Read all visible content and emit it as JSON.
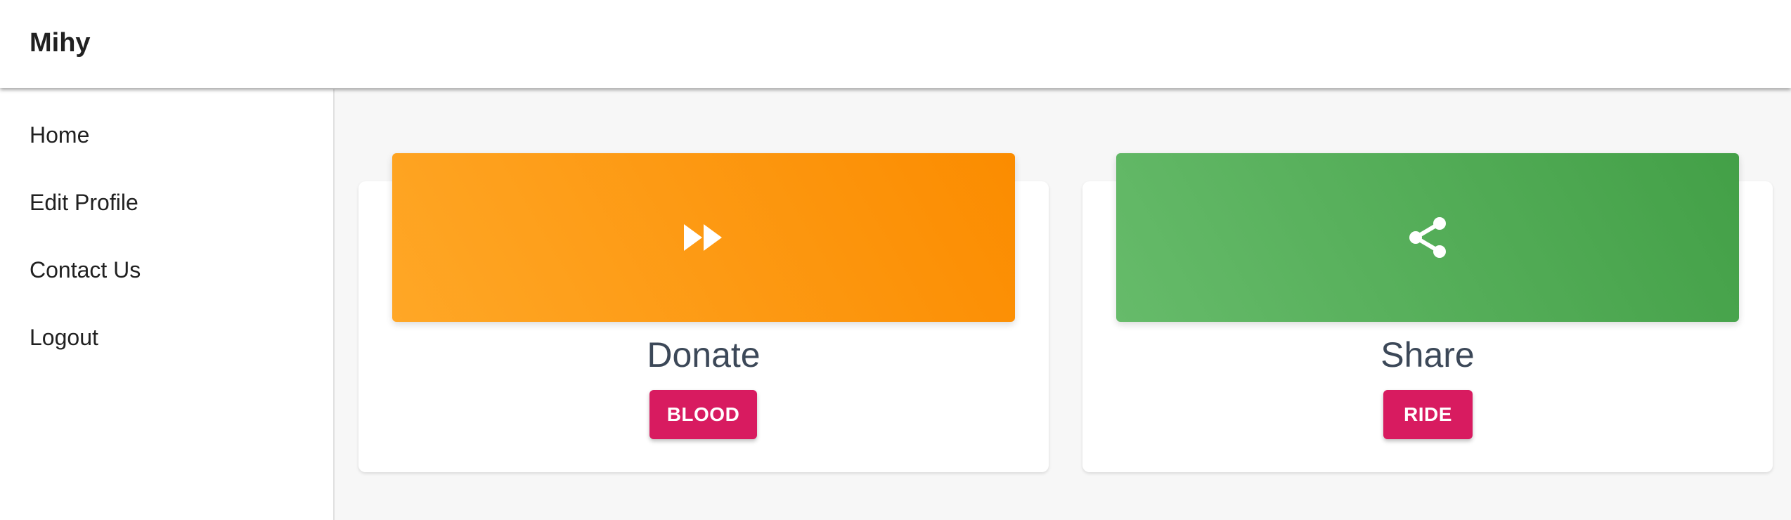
{
  "header": {
    "title": "Mihy"
  },
  "sidebar": {
    "items": [
      {
        "label": "Home"
      },
      {
        "label": "Edit Profile"
      },
      {
        "label": "Contact Us"
      },
      {
        "label": "Logout"
      }
    ]
  },
  "cards": [
    {
      "title": "Donate",
      "button_label": "BLOOD",
      "icon": "fast-forward-icon",
      "gradient_start": "#ffa726",
      "gradient_end": "#fb8c00"
    },
    {
      "title": "Share",
      "button_label": "RIDE",
      "icon": "share-icon",
      "gradient_start": "#66bb6a",
      "gradient_end": "#43a047"
    }
  ],
  "colors": {
    "button": "#d81b60",
    "title_text": "#3c4858"
  }
}
